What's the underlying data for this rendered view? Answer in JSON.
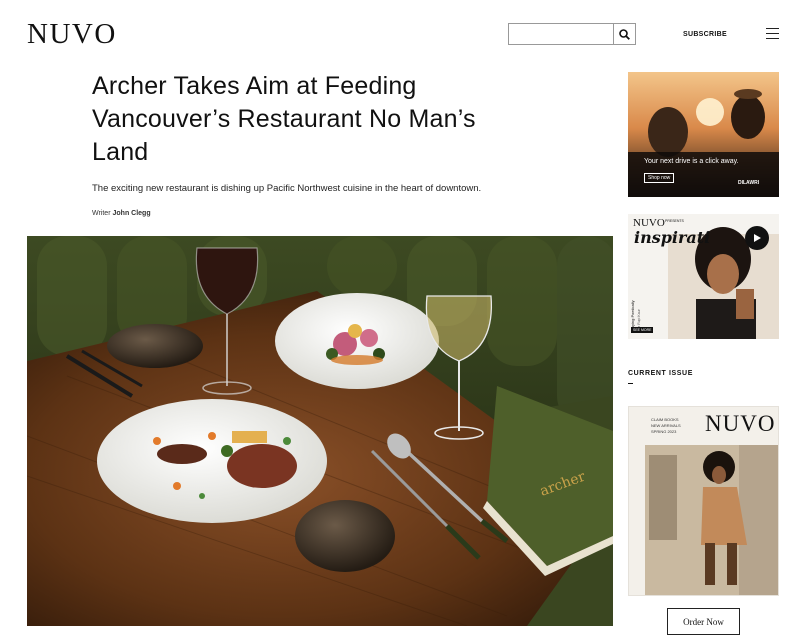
{
  "header": {
    "logo": "NUVO",
    "search_placeholder": "",
    "search_icon": "search-icon",
    "subscribe_label": "SUBSCRIBE",
    "menu_icon": "hamburger-menu-icon"
  },
  "article": {
    "title": "Archer Takes Aim at Feeding Vancouver’s Restaurant No Man’s Land",
    "dek": "The exciting new restaurant is dishing up Pacific Northwest cuisine in the heart of downtown.",
    "byline_role": "Writer",
    "byline_name": "John Clegg",
    "hero_menu_text": "archer"
  },
  "sidebar": {
    "ad1": {
      "tagline": "Your next drive is a click away.",
      "cta": "Shop now",
      "brand": "DILAWRI"
    },
    "ad2": {
      "brand": "NUVO",
      "presents": "PRESENTS",
      "title": "inspirati",
      "subtitle": "Staying Poetically",
      "subtitle2": "with Rupi Kaur",
      "label": "SEE MORE"
    },
    "current_issue_label": "CURRENT ISSUE",
    "cover": {
      "masthead": "NUVO",
      "lines": [
        "CLAIM BOOKS",
        "NEW ARRIVALS",
        "SPRING 2023"
      ]
    },
    "order_label": "Order Now"
  },
  "colors": {
    "text": "#111111",
    "olive": "#4a5a2a",
    "wood": "#6b3a1a"
  }
}
